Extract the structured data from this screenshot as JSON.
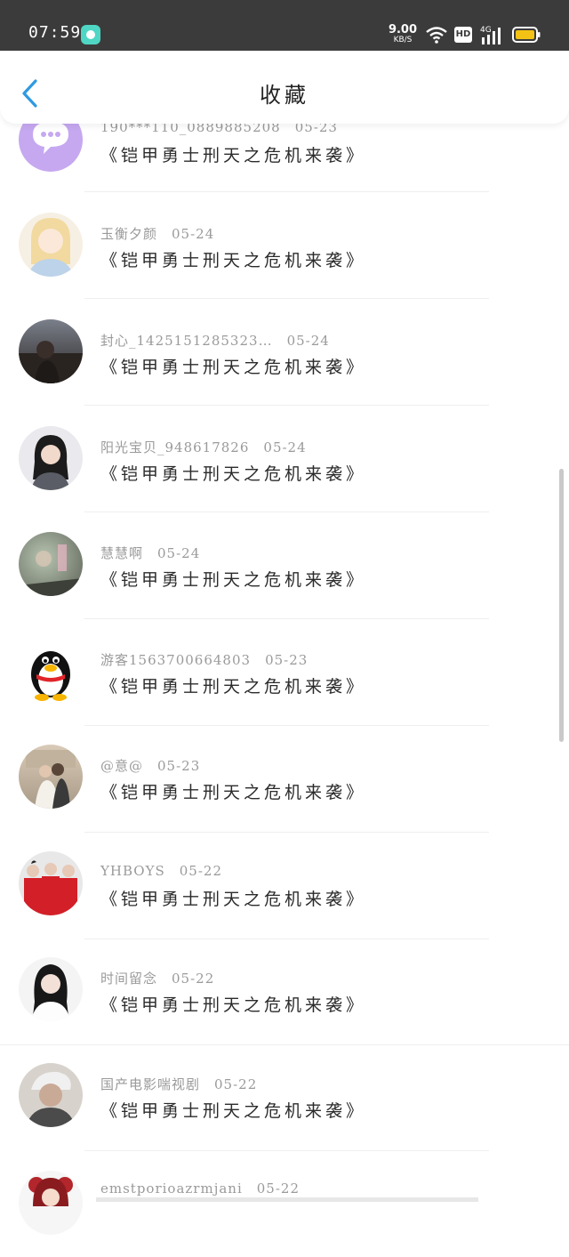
{
  "status_bar": {
    "time": "07:59",
    "speed_value": "9.00",
    "speed_unit": "KB/S",
    "hd_label": "HD",
    "network_label": "4G",
    "icons": [
      "app-notification-icon",
      "wifi-icon",
      "hd-icon",
      "signal-icon",
      "battery-icon"
    ]
  },
  "header": {
    "back_icon": "chevron-left-icon",
    "title": "收藏",
    "accent_color": "#2f9ae0"
  },
  "list": {
    "items": [
      {
        "user": "190***110_0889885208",
        "date": "05-23",
        "title": "《铠甲勇士刑天之危机来袭》",
        "avatar": "purple-chat-icon"
      },
      {
        "user": "玉衡夕颜",
        "date": "05-24",
        "title": "《铠甲勇士刑天之危机来袭》",
        "avatar": "anime-girl"
      },
      {
        "user": "封心_14251512853​23…",
        "date": "05-24",
        "title": "《铠甲勇士刑天之危机来袭》",
        "avatar": "dusk-photo"
      },
      {
        "user": "阳光宝贝_948617826",
        "date": "05-24",
        "title": "《铠甲勇士刑天之危机来袭》",
        "avatar": "girl-portrait"
      },
      {
        "user": "慧慧啊",
        "date": "05-24",
        "title": "《铠甲勇士刑天之危机来袭》",
        "avatar": "blurry-photo"
      },
      {
        "user": "游客1563700664803",
        "date": "05-23",
        "title": "《铠甲勇士刑天之危机来袭》",
        "avatar": "qq-penguin"
      },
      {
        "user": "@意@",
        "date": "05-23",
        "title": "《铠甲勇士刑天之危机来袭》",
        "avatar": "wedding-photo"
      },
      {
        "user": "YHBOYS",
        "date": "05-22",
        "title": "《铠甲勇士刑天之危机来袭》",
        "avatar": "group-red"
      },
      {
        "user": "时间留念",
        "date": "05-22",
        "title": "《铠甲勇士刑天之危机来袭》",
        "avatar": "girl-white"
      },
      {
        "user": "国产电影喘视剧",
        "date": "05-22",
        "title": "《铠甲勇士刑天之危机来袭》",
        "avatar": "boy-photo"
      },
      {
        "user": "emstporioazrmjani",
        "date": "05-22",
        "title": "",
        "avatar": "red-hair"
      }
    ]
  }
}
